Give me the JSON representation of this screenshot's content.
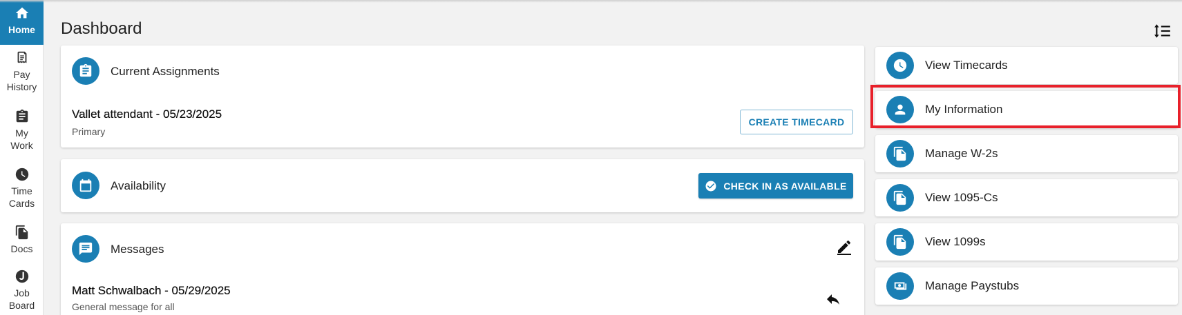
{
  "sidebar": {
    "items": [
      {
        "label_line1": "Home",
        "label_line2": "",
        "icon": "home-icon",
        "active": true
      },
      {
        "label_line1": "Pay",
        "label_line2": "History",
        "icon": "receipt-icon",
        "active": false
      },
      {
        "label_line1": "My",
        "label_line2": "Work",
        "icon": "clipboard-icon",
        "active": false
      },
      {
        "label_line1": "Time",
        "label_line2": "Cards",
        "icon": "clock-icon",
        "active": false
      },
      {
        "label_line1": "Docs",
        "label_line2": "",
        "icon": "documents-icon",
        "active": false
      },
      {
        "label_line1": "Job",
        "label_line2": "Board",
        "icon": "job-board-icon",
        "active": false
      }
    ]
  },
  "page": {
    "title": "Dashboard",
    "sort_icon": "sort-list-icon"
  },
  "assignments": {
    "title": "Current Assignments",
    "item_title": "Vallet attendant - 05/23/2025",
    "item_sub": "Primary",
    "button_label": "CREATE TIMECARD"
  },
  "availability": {
    "title": "Availability",
    "button_label": "CHECK IN AS AVAILABLE"
  },
  "messages": {
    "title": "Messages",
    "item_title": "Matt Schwalbach - 05/29/2025",
    "item_sub": "General message for all"
  },
  "quick_links": [
    {
      "label": "View Timecards",
      "icon": "clock-icon"
    },
    {
      "label": "My Information",
      "icon": "person-icon",
      "highlighted": true
    },
    {
      "label": "Manage W-2s",
      "icon": "copy-document-icon"
    },
    {
      "label": "View 1095-Cs",
      "icon": "copy-document-icon"
    },
    {
      "label": "View 1099s",
      "icon": "copy-document-icon"
    },
    {
      "label": "Manage Paystubs",
      "icon": "money-icon"
    }
  ],
  "colors": {
    "accent": "#1a7fb4",
    "highlight": "#e8202a",
    "background": "#f2f2f2"
  }
}
